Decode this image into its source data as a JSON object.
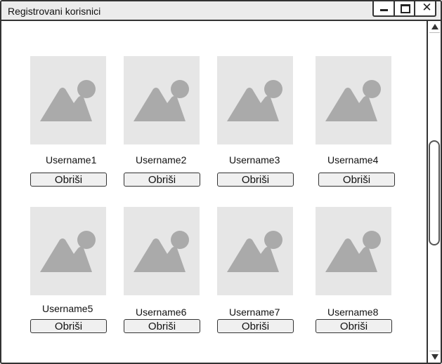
{
  "window": {
    "title": "Registrovani korisnici"
  },
  "users": [
    {
      "username": "Username1",
      "delete_label": "Obriši"
    },
    {
      "username": "Username2",
      "delete_label": "Obriši"
    },
    {
      "username": "Username3",
      "delete_label": "Obriši"
    },
    {
      "username": "Username4",
      "delete_label": "Obriši"
    },
    {
      "username": "Username5",
      "delete_label": "Obriši"
    },
    {
      "username": "Username6",
      "delete_label": "Obriši"
    },
    {
      "username": "Username7",
      "delete_label": "Obriši"
    },
    {
      "username": "Username8",
      "delete_label": "Obriši"
    }
  ],
  "icons": {
    "window_controls": [
      "minimize-icon",
      "maximize-icon",
      "close-icon"
    ],
    "user_image": "image-placeholder-icon",
    "scroll": [
      "arrow-up-icon",
      "arrow-down-icon"
    ]
  },
  "colors": {
    "placeholder_bg": "#e6e6e6",
    "placeholder_icon": "#aaaaaa",
    "border": "#333333"
  }
}
